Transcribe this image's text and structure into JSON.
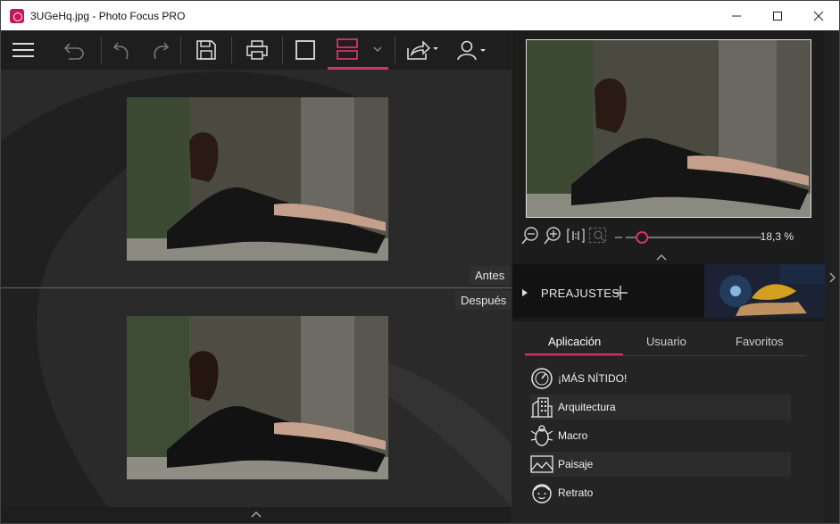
{
  "window": {
    "title": "3UGeHq.jpg - Photo Focus PRO"
  },
  "toolbar": {
    "icons": [
      "menu-icon",
      "undo-history-icon",
      "undo-icon",
      "redo-icon",
      "save-icon",
      "print-icon",
      "single-view-icon",
      "split-view-icon",
      "chevron-down-icon",
      "share-icon",
      "user-icon"
    ],
    "accent_color": "#d6336c"
  },
  "viewport": {
    "before_label": "Antes",
    "after_label": "Después"
  },
  "navigator": {
    "zoom_percent": "18,3 %",
    "zoom_fraction": 0.12
  },
  "presets": {
    "title": "PREAJUSTES"
  },
  "tabs": [
    {
      "label": "Aplicación",
      "active": true
    },
    {
      "label": "Usuario",
      "active": false
    },
    {
      "label": "Favoritos",
      "active": false
    }
  ],
  "preset_items": [
    {
      "label": "¡MÁS NÍTIDO!",
      "icon": "gauge-icon"
    },
    {
      "label": "Arquitectura",
      "icon": "building-icon"
    },
    {
      "label": "Macro",
      "icon": "bug-icon"
    },
    {
      "label": "Paisaje",
      "icon": "landscape-icon"
    },
    {
      "label": "Retrato",
      "icon": "face-icon"
    }
  ]
}
